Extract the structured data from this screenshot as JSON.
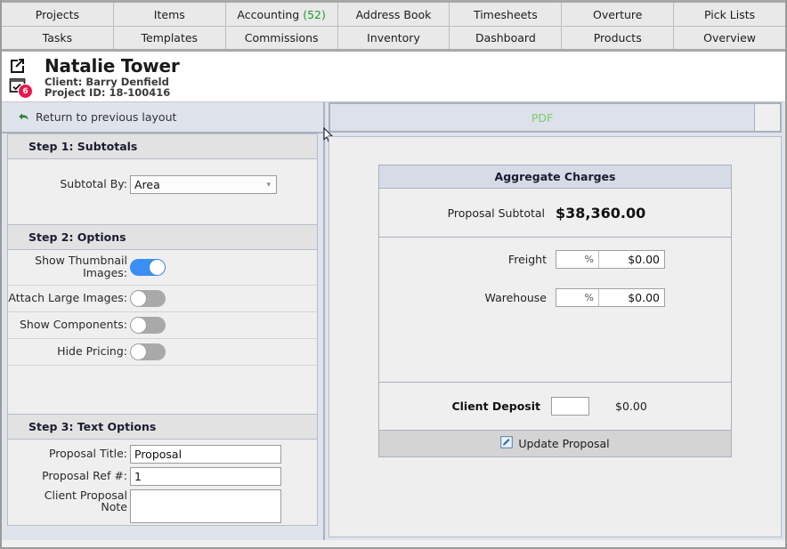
{
  "nav": {
    "row1": [
      {
        "label": "Projects"
      },
      {
        "label": "Items"
      },
      {
        "label": "Accounting",
        "count": "(52)"
      },
      {
        "label": "Address Book"
      },
      {
        "label": "Timesheets"
      },
      {
        "label": "Overture"
      },
      {
        "label": "Pick Lists"
      }
    ],
    "row2": [
      {
        "label": "Tasks"
      },
      {
        "label": "Templates"
      },
      {
        "label": "Commissions"
      },
      {
        "label": "Inventory"
      },
      {
        "label": "Dashboard"
      },
      {
        "label": "Products"
      },
      {
        "label": "Overview"
      }
    ],
    "accent_count_color": "#1f9a2f"
  },
  "header": {
    "project_name": "Natalie Tower",
    "client_line": "Client: Barry Denfield",
    "project_id_line": "Project ID: 18-100416",
    "open_external_icon": "external-link-icon",
    "tasks_icon": "calendar-check-icon",
    "task_badge_count": "6",
    "badge_color": "#e8174a"
  },
  "return_bar": {
    "label": "Return to previous layout",
    "icon": "undo-arrow-icon",
    "icon_color": "#2f7d32"
  },
  "left_panel": {
    "step1": {
      "title": "Step 1: Subtotals",
      "subtotal_by_label": "Subtotal By:",
      "subtotal_by_value": "Area",
      "subtotal_by_options": [
        "Area"
      ]
    },
    "step2": {
      "title": "Step 2: Options",
      "options": [
        {
          "label": "Show Thumbnail Images:",
          "state": "on"
        },
        {
          "label": "Attach Large Images:",
          "state": "off"
        },
        {
          "label": "Show Components:",
          "state": "off"
        },
        {
          "label": "Hide Pricing:",
          "state": "off"
        }
      ],
      "toggle_on_color": "#3b8ef3",
      "toggle_off_color": "#a9a9a9"
    },
    "step3": {
      "title": "Step 3: Text Options",
      "proposal_title_label": "Proposal Title:",
      "proposal_title_value": "Proposal",
      "proposal_ref_label": "Proposal Ref #:",
      "proposal_ref_value": "1",
      "client_note_label_line1": "Client Proposal",
      "client_note_label_line2": "Note",
      "client_note_value": ""
    }
  },
  "right_panel": {
    "tabs": [
      {
        "label": "PDF",
        "active": true
      }
    ],
    "tab_text_color": "#7ecb6a",
    "aggregate": {
      "title": "Aggregate Charges",
      "subtotal_label": "Proposal  Subtotal",
      "subtotal_value": "$38,360.00",
      "rows": [
        {
          "label": "Freight",
          "pct": "%",
          "amount": "$0.00"
        },
        {
          "label": "Warehouse",
          "pct": "%",
          "amount": "$0.00"
        }
      ],
      "deposit_label": "Client Deposit",
      "deposit_input_value": "",
      "deposit_value": "$0.00",
      "update_button_label": "Update Proposal",
      "update_button_icon": "pencil-edit-icon"
    }
  }
}
